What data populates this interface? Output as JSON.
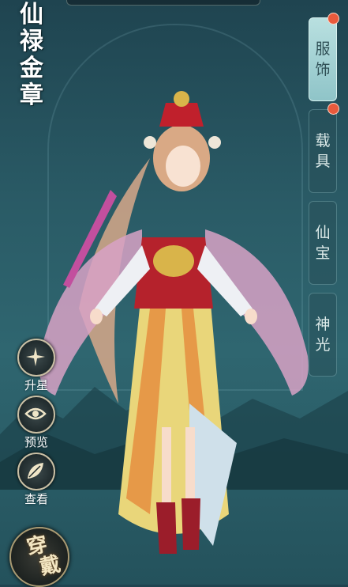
{
  "title": {
    "chars": [
      "仙",
      "禄",
      "金",
      "章"
    ]
  },
  "tabs": [
    {
      "chars": [
        "服",
        "饰"
      ],
      "active": true,
      "badge": true
    },
    {
      "chars": [
        "载",
        "具"
      ],
      "active": false,
      "badge": true
    },
    {
      "chars": [
        "仙",
        "宝"
      ],
      "active": false,
      "badge": false
    },
    {
      "chars": [
        "神",
        "光"
      ],
      "active": false,
      "badge": false
    }
  ],
  "left_buttons": [
    {
      "label": "升星",
      "icon": "star-upgrade-icon"
    },
    {
      "label": "预览",
      "icon": "eye-icon"
    },
    {
      "label": "查看",
      "icon": "leaf-view-icon"
    }
  ],
  "wear_button": {
    "chars": [
      "穿",
      "戴"
    ]
  },
  "colors": {
    "accent": "#e85a3c",
    "active_tab": "#a9d6d8",
    "gold": "#c9bfa4"
  }
}
